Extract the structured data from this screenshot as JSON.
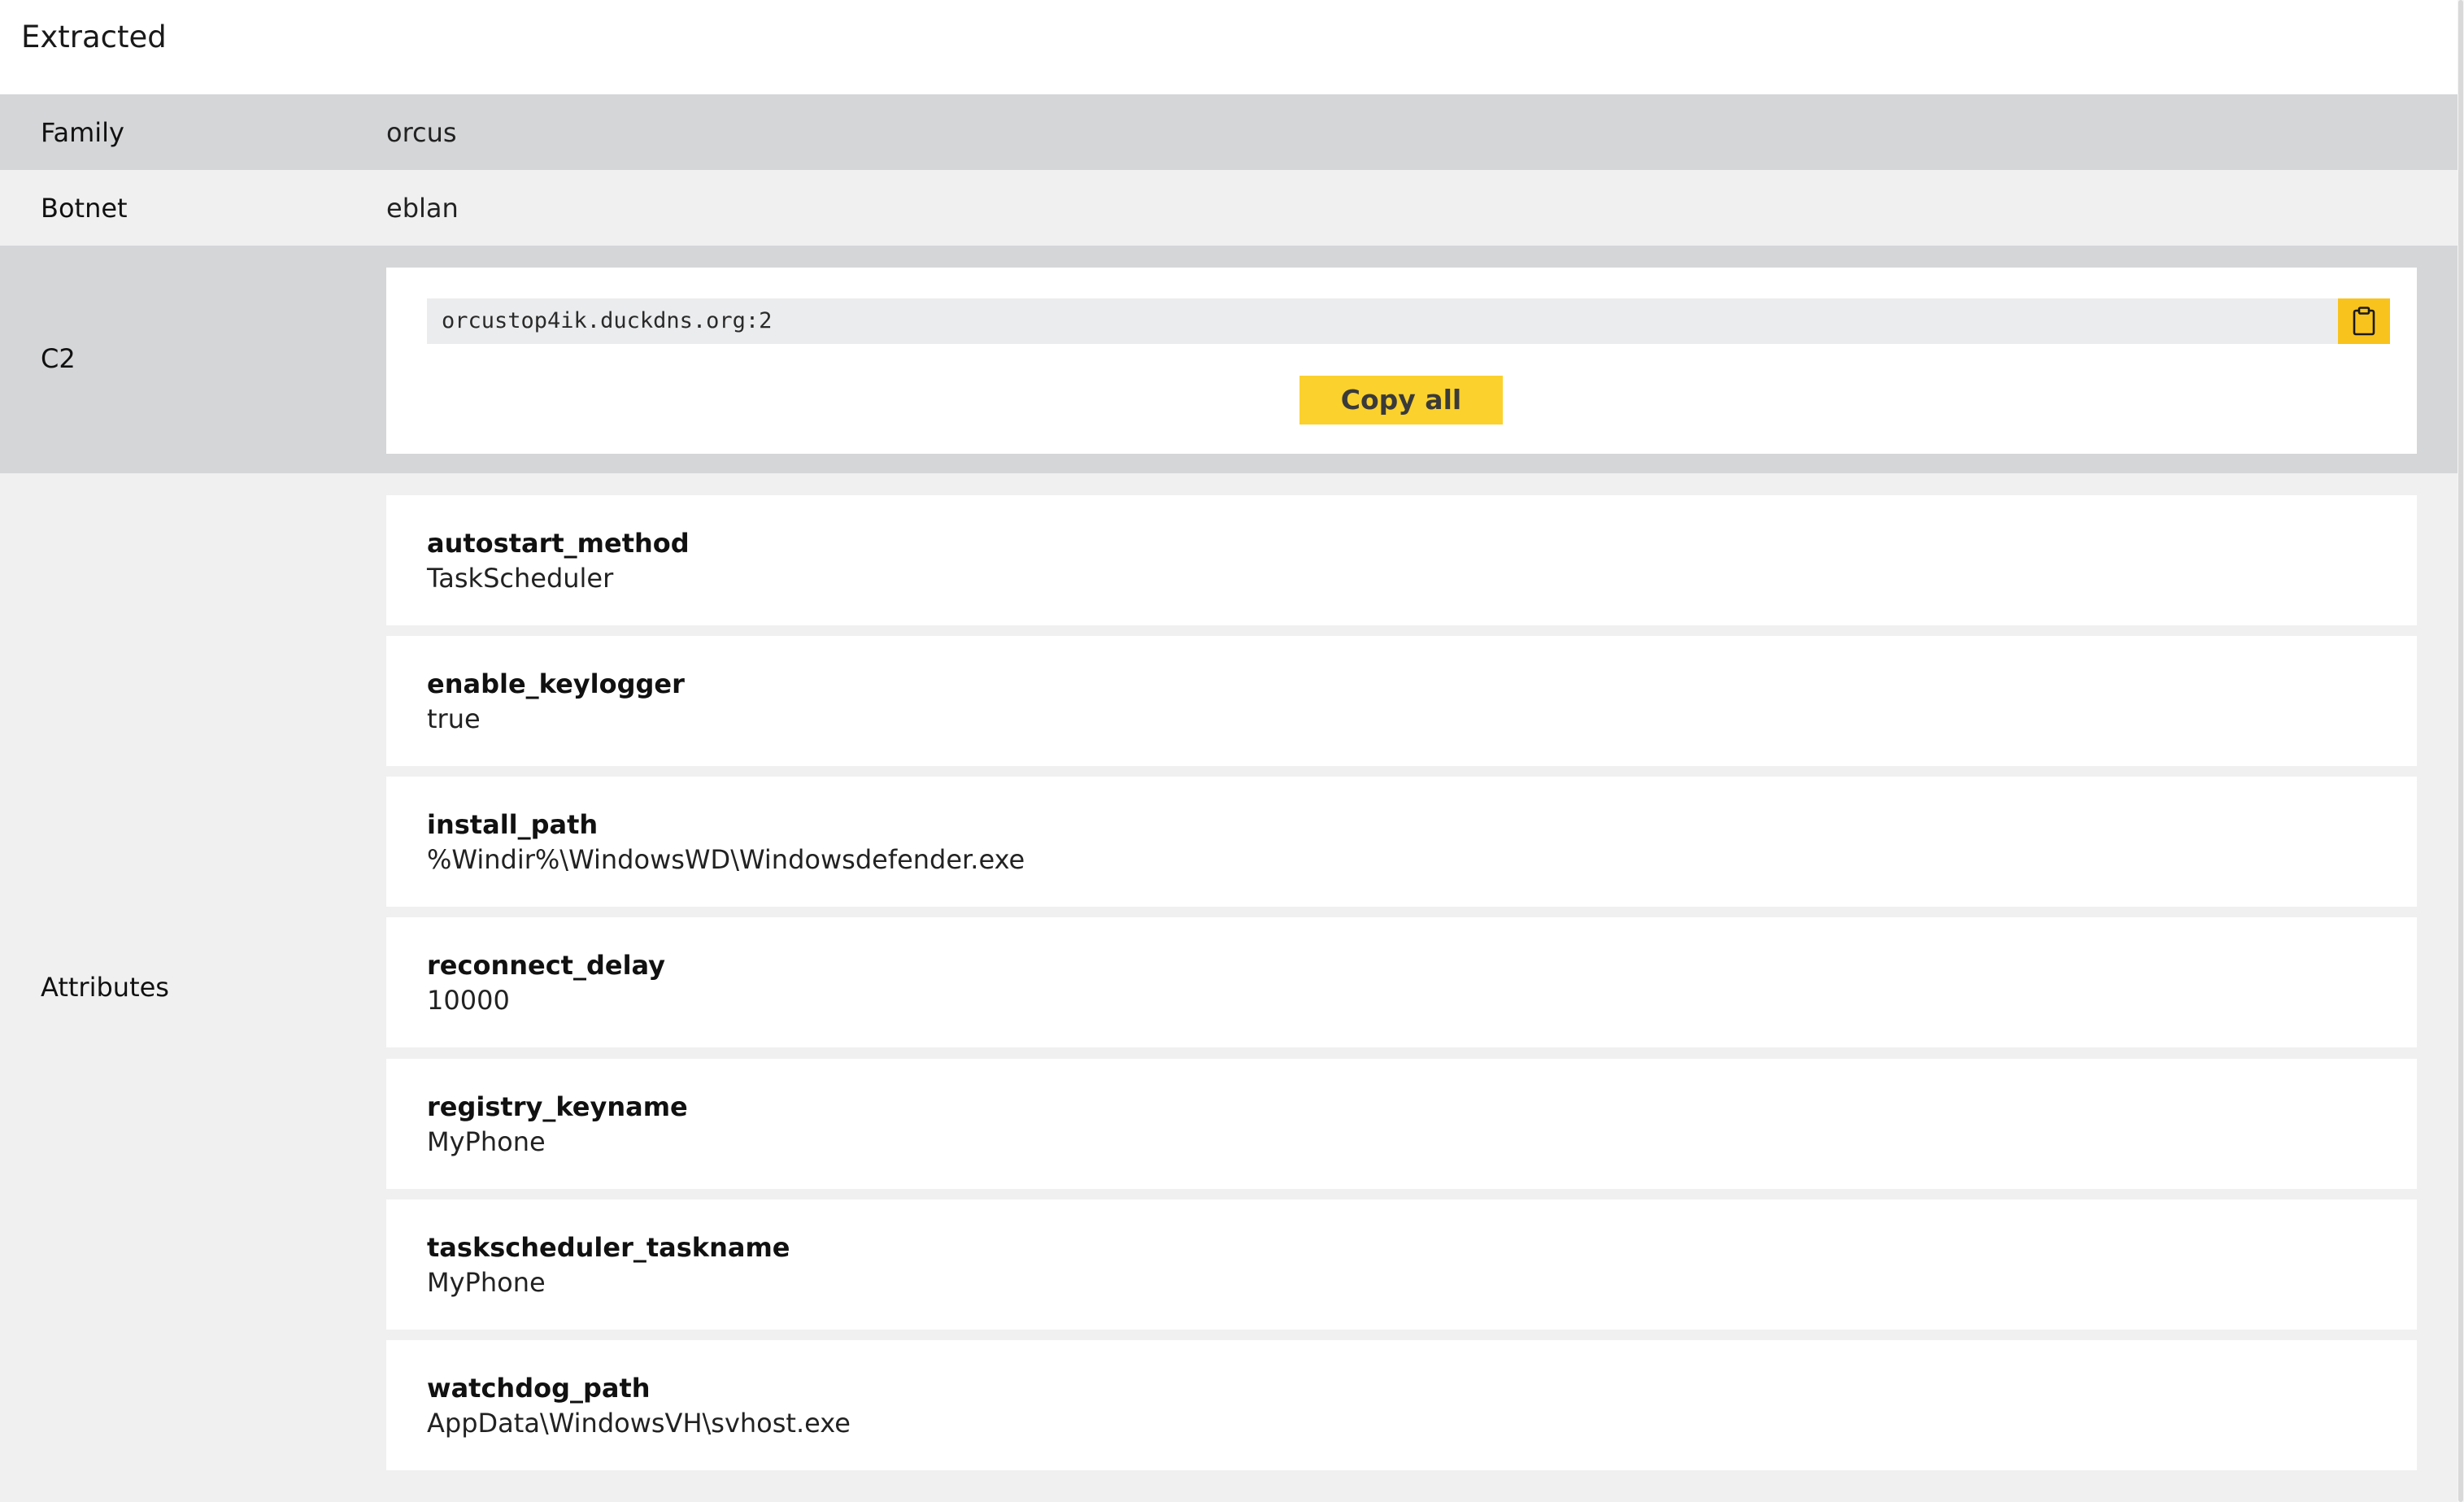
{
  "header": {
    "title": "Extracted"
  },
  "rows": {
    "family": {
      "label": "Family",
      "value": "orcus"
    },
    "botnet": {
      "label": "Botnet",
      "value": "eblan"
    },
    "c2": {
      "label": "C2",
      "entries": [
        "orcustop4ik.duckdns.org:2"
      ],
      "copy_icon": "clipboard-icon",
      "copy_all_label": "Copy all"
    },
    "attributes": {
      "label": "Attributes",
      "items": [
        {
          "key": "autostart_method",
          "value": "TaskScheduler"
        },
        {
          "key": "enable_keylogger",
          "value": "true"
        },
        {
          "key": "install_path",
          "value": "%Windir%\\WindowsWD\\Windowsdefender.exe"
        },
        {
          "key": "reconnect_delay",
          "value": "10000"
        },
        {
          "key": "registry_keyname",
          "value": "MyPhone"
        },
        {
          "key": "taskscheduler_taskname",
          "value": "MyPhone"
        },
        {
          "key": "watchdog_path",
          "value": "AppData\\WindowsVH\\svhost.exe"
        }
      ]
    }
  },
  "colors": {
    "accent": "#f9c31d",
    "row_dark": "#d5d6d8",
    "row_light": "#f0f0f0"
  }
}
